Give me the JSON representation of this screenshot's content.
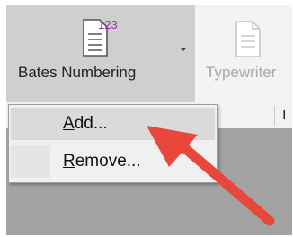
{
  "ribbon": {
    "bates_label": "Bates Numbering",
    "bates_icon_number": "123",
    "typewriter_label": "Typewriter",
    "group_label_partial": "I"
  },
  "menu": {
    "items": [
      {
        "label_mnemonic": "A",
        "label_rest": "dd...",
        "highlighted": true
      },
      {
        "label_mnemonic": "R",
        "label_rest": "emove...",
        "highlighted": false
      }
    ]
  },
  "annotation": {
    "arrow_color": "#e8483b"
  },
  "icons": {
    "bates": "bates-numbering-document-icon",
    "typewriter": "typewriter-document-icon",
    "dropdown": "caret-down-icon"
  }
}
